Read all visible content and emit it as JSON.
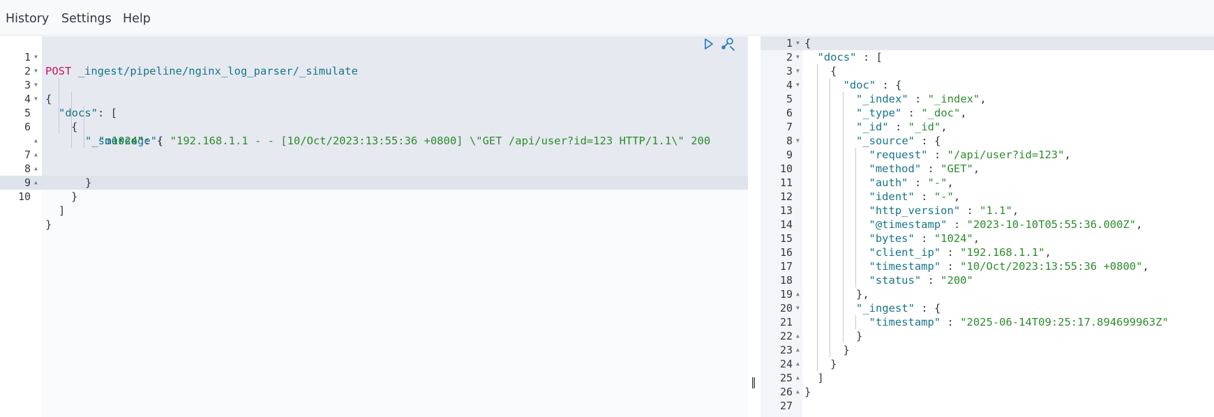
{
  "menu": {
    "history": "History",
    "settings": "Settings",
    "help": "Help"
  },
  "request": {
    "method": "POST",
    "path": " _ingest/pipeline/nginx_log_parser/_simulate",
    "line_numbers": [
      "1",
      "2",
      "3",
      "4",
      "5",
      "6",
      "7",
      "8",
      "9",
      "10"
    ],
    "lines": {
      "l2": "{",
      "l3_key": "\"docs\"",
      "l3_rest": ": [",
      "l4": "{",
      "l5_key": "\"_source\"",
      "l5_rest": ": {",
      "l6_key": "\"message\"",
      "l6_colon": ": ",
      "l6_value": "\"192.168.1.1 - - [10/Oct/2023:13:55:36 +0800] \\\"GET /api/user?id=123 HTTP/1.1\\\" 200",
      "l6_wrap": "1024\"",
      "l7": "}",
      "l8": "}",
      "l9": "]",
      "l10": "}"
    },
    "icons": {
      "run": "play-icon",
      "settings": "wrench-icon"
    }
  },
  "response": {
    "line_numbers": [
      "1",
      "2",
      "3",
      "4",
      "5",
      "6",
      "7",
      "8",
      "9",
      "10",
      "11",
      "12",
      "13",
      "14",
      "15",
      "16",
      "17",
      "18",
      "19",
      "20",
      "21",
      "22",
      "23",
      "24",
      "25",
      "26",
      "27"
    ],
    "lines": [
      {
        "indent": 0,
        "key": "",
        "value": "",
        "punc": "{"
      },
      {
        "indent": 1,
        "key": "\"docs\"",
        "value": "",
        "punc": " : ["
      },
      {
        "indent": 2,
        "key": "",
        "value": "",
        "punc": "{"
      },
      {
        "indent": 3,
        "key": "\"doc\"",
        "value": "",
        "punc": " : {"
      },
      {
        "indent": 4,
        "key": "\"_index\"",
        "value": "\"_index\"",
        "punc": ","
      },
      {
        "indent": 4,
        "key": "\"_type\"",
        "value": "\"_doc\"",
        "punc": ","
      },
      {
        "indent": 4,
        "key": "\"_id\"",
        "value": "\"_id\"",
        "punc": ","
      },
      {
        "indent": 4,
        "key": "\"_source\"",
        "value": "",
        "punc": " : {"
      },
      {
        "indent": 5,
        "key": "\"request\"",
        "value": "\"/api/user?id=123\"",
        "punc": ","
      },
      {
        "indent": 5,
        "key": "\"method\"",
        "value": "\"GET\"",
        "punc": ","
      },
      {
        "indent": 5,
        "key": "\"auth\"",
        "value": "\"-\"",
        "punc": ","
      },
      {
        "indent": 5,
        "key": "\"ident\"",
        "value": "\"-\"",
        "punc": ","
      },
      {
        "indent": 5,
        "key": "\"http_version\"",
        "value": "\"1.1\"",
        "punc": ","
      },
      {
        "indent": 5,
        "key": "\"@timestamp\"",
        "value": "\"2023-10-10T05:55:36.000Z\"",
        "punc": ","
      },
      {
        "indent": 5,
        "key": "\"bytes\"",
        "value": "\"1024\"",
        "punc": ","
      },
      {
        "indent": 5,
        "key": "\"client_ip\"",
        "value": "\"192.168.1.1\"",
        "punc": ","
      },
      {
        "indent": 5,
        "key": "\"timestamp\"",
        "value": "\"10/Oct/2023:13:55:36 +0800\"",
        "punc": ","
      },
      {
        "indent": 5,
        "key": "\"status\"",
        "value": "\"200\"",
        "punc": ""
      },
      {
        "indent": 4,
        "key": "",
        "value": "",
        "punc": "},"
      },
      {
        "indent": 4,
        "key": "\"_ingest\"",
        "value": "",
        "punc": " : {"
      },
      {
        "indent": 5,
        "key": "\"timestamp\"",
        "value": "\"2025-06-14T09:25:17.894699963Z\"",
        "punc": ""
      },
      {
        "indent": 4,
        "key": "",
        "value": "",
        "punc": "}"
      },
      {
        "indent": 3,
        "key": "",
        "value": "",
        "punc": "}"
      },
      {
        "indent": 2,
        "key": "",
        "value": "",
        "punc": "}"
      },
      {
        "indent": 1,
        "key": "",
        "value": "",
        "punc": "]"
      },
      {
        "indent": 0,
        "key": "",
        "value": "",
        "punc": "}"
      },
      {
        "indent": 0,
        "key": "",
        "value": "",
        "punc": ""
      }
    ],
    "folds": {
      "1": "open",
      "2": "open",
      "3": "open",
      "4": "open",
      "8": "open",
      "19": "close",
      "20": "open",
      "22": "close",
      "23": "close",
      "24": "close",
      "25": "close",
      "26": "close"
    }
  },
  "divider_glyph": "‖",
  "colors": {
    "keyword": "#c6175c",
    "key": "#17758a",
    "string": "#2c8c2c"
  }
}
